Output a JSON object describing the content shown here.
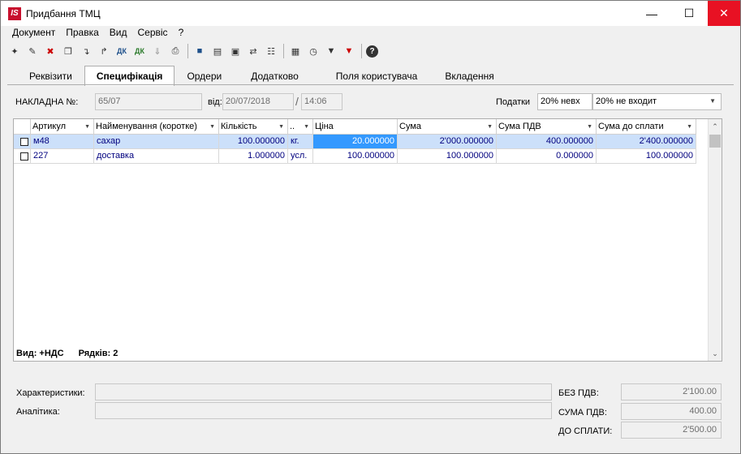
{
  "window": {
    "title": "Придбання ТМЦ",
    "logo_text": "IS"
  },
  "menu": [
    "Документ",
    "Правка",
    "Вид",
    "Сервіс",
    "?"
  ],
  "toolbar": {
    "buttons": [
      "new-doc-icon",
      "edit-doc-icon",
      "delete-doc-icon",
      "copy-icon",
      "import-icon",
      "export-icon",
      "debit-credit-icon",
      "debit-credit-green-icon",
      "move-down-icon",
      "print-icon",
      "save-icon",
      "book-icon",
      "book-open-icon",
      "exchange-icon",
      "tree-icon",
      "table-icon",
      "history-icon",
      "filter-icon",
      "clear-filter-icon",
      "help-icon"
    ]
  },
  "tabs": [
    "Реквізити",
    "Специфікація",
    "Ордери",
    "Додатково",
    "Поля користувача",
    "Вкладення"
  ],
  "header": {
    "invoice_label": "НАКЛАДНА №:",
    "invoice_no": "65/07",
    "date_label": "від:",
    "date": "20/07/2018",
    "slash": "/",
    "time": "14:06",
    "tax_label": "Податки",
    "tax_rate": "20% невх",
    "tax_mode": "20% не входит"
  },
  "grid": {
    "columns": [
      "",
      "Артикул",
      "Найменування (коротке)",
      "Кількість",
      "..",
      "Ціна",
      "Сума",
      "Сума ПДВ",
      "Сума до сплати"
    ],
    "rows": [
      {
        "article": "м48",
        "name": "сахар",
        "qty": "100.000000",
        "unit": "кг.",
        "price": "20.000000",
        "sum": "2'000.000000",
        "vat": "400.000000",
        "total": "2'400.000000",
        "selected": true
      },
      {
        "article": "227",
        "name": "доставка",
        "qty": "1.000000",
        "unit": "усл.",
        "price": "100.000000",
        "sum": "100.000000",
        "vat": "0.000000",
        "total": "100.000000",
        "selected": false
      }
    ],
    "footer_view": "Вид: +НДС",
    "footer_rows": "Рядків: 2"
  },
  "bottom": {
    "characteristics_label": "Характеристики:",
    "analytics_label": "Аналітика:",
    "no_vat_label": "БЕЗ ПДВ:",
    "no_vat_value": "2'100.00",
    "vat_sum_label": "СУМА ПДВ:",
    "vat_sum_value": "400.00",
    "to_pay_label": "ДО СПЛАТИ:",
    "to_pay_value": "2'500.00"
  }
}
